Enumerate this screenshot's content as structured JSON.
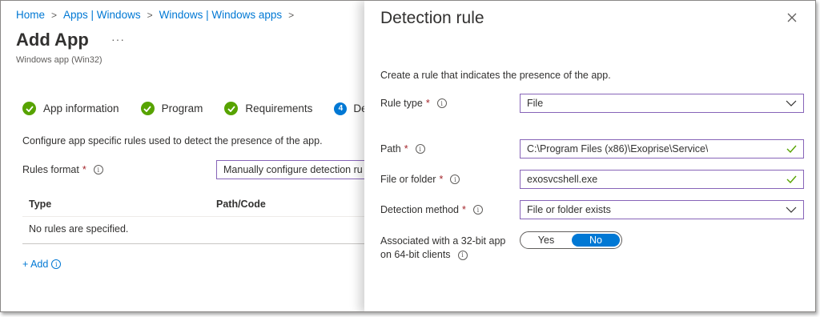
{
  "breadcrumb": [
    "Home",
    "Apps | Windows",
    "Windows | Windows apps"
  ],
  "page": {
    "title": "Add App",
    "more": "···",
    "subtitle": "Windows app (Win32)"
  },
  "steps": [
    {
      "label": "App information",
      "done": true
    },
    {
      "label": "Program",
      "done": true
    },
    {
      "label": "Requirements",
      "done": true
    },
    {
      "number": "4",
      "label": "De"
    }
  ],
  "detection": {
    "configure_text": "Configure app specific rules used to detect the presence of the app.",
    "rules_format_label": "Rules format",
    "rules_format_value": "Manually configure detection ru",
    "columns": [
      "Type",
      "Path/Code"
    ],
    "empty_text": "No rules are specified.",
    "add_label": "+ Add"
  },
  "panel": {
    "title": "Detection rule",
    "intro": "Create a rule that indicates the presence of the app.",
    "rule_type": {
      "label": "Rule type",
      "value": "File"
    },
    "path": {
      "label": "Path",
      "value": "C:\\Program Files (x86)\\Exoprise\\Service\\"
    },
    "file_or_folder": {
      "label": "File or folder",
      "value": "exosvcshell.exe"
    },
    "detection_method": {
      "label": "Detection method",
      "value": "File or folder exists"
    },
    "associated_32bit": {
      "label_line1": "Associated with a 32-bit app",
      "label_line2": "on 64-bit clients",
      "yes": "Yes",
      "no": "No",
      "selected": "No"
    }
  },
  "symbols": {
    "required": "*",
    "info": "i",
    "separator": ">"
  },
  "colors": {
    "accent": "#0078d4",
    "success": "#57a300",
    "required": "#a4262c",
    "focus_border": "#8764b8"
  }
}
